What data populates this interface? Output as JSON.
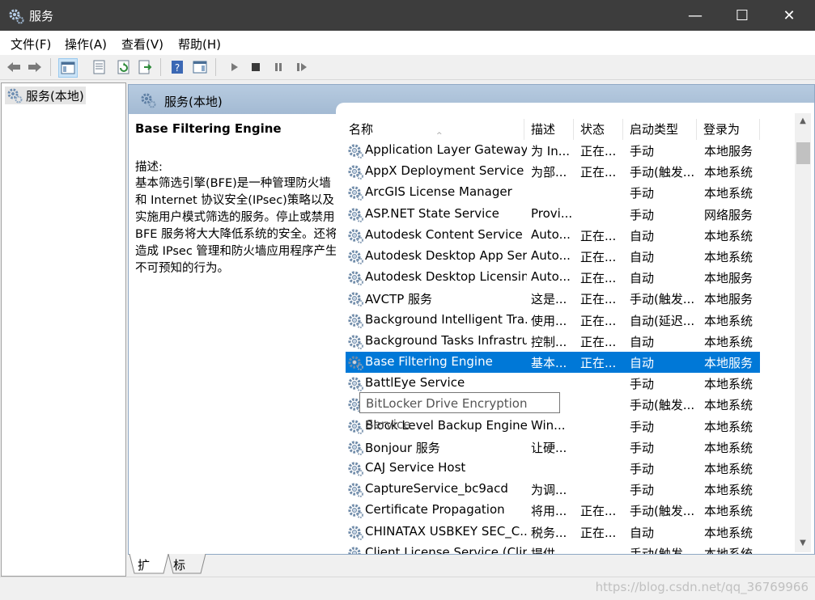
{
  "window": {
    "title": "服务",
    "minimize": "—",
    "maximize": "☐",
    "close": "✕"
  },
  "menu": {
    "file": "文件(F)",
    "action": "操作(A)",
    "view": "查看(V)",
    "help": "帮助(H)"
  },
  "tree": {
    "root_label": "服务(本地)"
  },
  "main": {
    "header_title": "服务(本地)",
    "selected_service": "Base Filtering Engine",
    "desc_label": "描述:",
    "desc_text": "基本筛选引擎(BFE)是一种管理防火墙和 Internet 协议安全(IPsec)策略以及实施用户模式筛选的服务。停止或禁用 BFE 服务将大大降低系统的安全。还将造成 IPsec 管理和防火墙应用程序产生不可预知的行为。"
  },
  "columns": {
    "name": "名称",
    "desc": "描述",
    "status": "状态",
    "startup": "启动类型",
    "logon": "登录为",
    "sort_indicator": "^"
  },
  "services": [
    {
      "name": "Application Layer Gateway ...",
      "desc": "为 In...",
      "status": "正在...",
      "startup": "手动",
      "logon": "本地服务"
    },
    {
      "name": "AppX Deployment Service ...",
      "desc": "为部...",
      "status": "正在...",
      "startup": "手动(触发...",
      "logon": "本地系统"
    },
    {
      "name": "ArcGIS License Manager",
      "desc": "",
      "status": "",
      "startup": "手动",
      "logon": "本地系统"
    },
    {
      "name": "ASP.NET State Service",
      "desc": "Provi...",
      "status": "",
      "startup": "手动",
      "logon": "网络服务"
    },
    {
      "name": "Autodesk Content Service",
      "desc": "Auto...",
      "status": "正在...",
      "startup": "自动",
      "logon": "本地系统"
    },
    {
      "name": "Autodesk Desktop App Ser...",
      "desc": "Auto...",
      "status": "正在...",
      "startup": "自动",
      "logon": "本地系统"
    },
    {
      "name": "Autodesk Desktop Licensin...",
      "desc": "Auto...",
      "status": "正在...",
      "startup": "自动",
      "logon": "本地服务"
    },
    {
      "name": "AVCTP 服务",
      "desc": "这是...",
      "status": "正在...",
      "startup": "手动(触发...",
      "logon": "本地服务"
    },
    {
      "name": "Background Intelligent Tra...",
      "desc": "使用...",
      "status": "正在...",
      "startup": "自动(延迟...",
      "logon": "本地系统"
    },
    {
      "name": "Background Tasks Infrastru...",
      "desc": "控制...",
      "status": "正在...",
      "startup": "自动",
      "logon": "本地系统"
    },
    {
      "name": "Base Filtering Engine",
      "desc": "基本...",
      "status": "正在...",
      "startup": "自动",
      "logon": "本地服务"
    },
    {
      "name": "BattlEye Service",
      "desc": "",
      "status": "",
      "startup": "手动",
      "logon": "本地系统"
    },
    {
      "name": "BitLocker Drive Encryption Service",
      "desc": "",
      "status": "",
      "startup": "手动(触发...",
      "logon": "本地系统"
    },
    {
      "name": "Block Level Backup Engine ...",
      "desc": "Win...",
      "status": "",
      "startup": "手动",
      "logon": "本地系统"
    },
    {
      "name": "Bonjour 服务",
      "desc": "让硬...",
      "status": "",
      "startup": "手动",
      "logon": "本地系统"
    },
    {
      "name": "CAJ Service Host",
      "desc": "",
      "status": "",
      "startup": "手动",
      "logon": "本地系统"
    },
    {
      "name": "CaptureService_bc9acd",
      "desc": "为调...",
      "status": "",
      "startup": "手动",
      "logon": "本地系统"
    },
    {
      "name": "Certificate Propagation",
      "desc": "将用...",
      "status": "正在...",
      "startup": "手动(触发...",
      "logon": "本地系统"
    },
    {
      "name": "CHINATAX USBKEY SEC_C...",
      "desc": "税务...",
      "status": "正在...",
      "startup": "自动",
      "logon": "本地系统"
    },
    {
      "name": "Client License Service (Clip...",
      "desc": "提供...",
      "status": "",
      "startup": "手动(触发...",
      "logon": "本地系统"
    }
  ],
  "tooltip": "BitLocker Drive Encryption Service",
  "tabs": {
    "extended": "扩展",
    "standard": "标准"
  },
  "watermark": "https://blog.csdn.net/qq_36769966",
  "colors": {
    "selection": "#0078d7",
    "titlebar": "#3d3d3d",
    "header": "#a3bad3"
  }
}
